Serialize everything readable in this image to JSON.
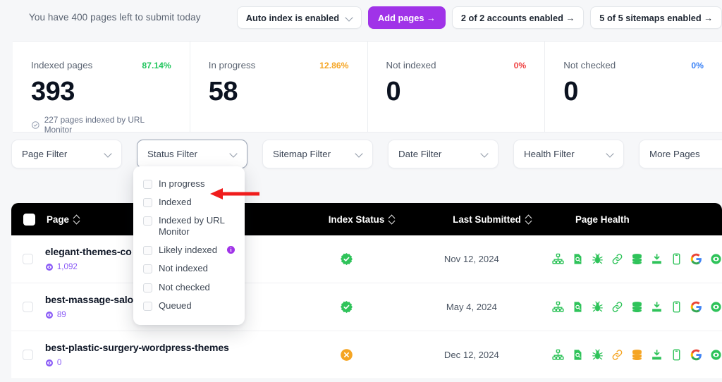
{
  "topbar": {
    "quota_text": "You have 400 pages left to submit today",
    "auto_index_label": "Auto index is enabled",
    "add_pages_label": "Add pages →",
    "accounts_label": "2 of 2 accounts enabled →",
    "sitemaps_label": "5 of 5 sitemaps enabled →"
  },
  "stats": [
    {
      "label": "Indexed pages",
      "percent": "87.14%",
      "percent_color": "#22c55e",
      "value": "393",
      "sub": "227 pages indexed by URL Monitor"
    },
    {
      "label": "In progress",
      "percent": "12.86%",
      "percent_color": "#f5a524",
      "value": "58",
      "sub": ""
    },
    {
      "label": "Not indexed",
      "percent": "0%",
      "percent_color": "#ef4444",
      "value": "0",
      "sub": ""
    },
    {
      "label": "Not checked",
      "percent": "0%",
      "percent_color": "#3b82f6",
      "value": "0",
      "sub": ""
    }
  ],
  "filters": [
    {
      "label": "Page Filter",
      "active": false
    },
    {
      "label": "Status Filter",
      "active": true
    },
    {
      "label": "Sitemap Filter",
      "active": false
    },
    {
      "label": "Date Filter",
      "active": false
    },
    {
      "label": "Health Filter",
      "active": false
    },
    {
      "label": "More Pages",
      "active": false
    }
  ],
  "status_dropdown": {
    "open": true,
    "options": [
      {
        "label": "In progress",
        "checked": false,
        "info": false
      },
      {
        "label": "Indexed",
        "checked": false,
        "info": false
      },
      {
        "label": "Indexed by URL Monitor",
        "checked": false,
        "info": false
      },
      {
        "label": "Likely indexed",
        "checked": false,
        "info": true
      },
      {
        "label": "Not indexed",
        "checked": false,
        "info": false
      },
      {
        "label": "Not checked",
        "checked": false,
        "info": false
      },
      {
        "label": "Queued",
        "checked": false,
        "info": false
      }
    ]
  },
  "annotation": {
    "arrow_color": "#f01c1c",
    "direction": "left"
  },
  "table": {
    "columns": {
      "page": "Page",
      "index_status": "Index Status",
      "last_submitted": "Last Submitted",
      "page_health": "Page Health"
    },
    "rows": [
      {
        "name": "elegant-themes-co",
        "views": "1,092",
        "status": "indexed",
        "last_submitted": "Nov 12, 2024",
        "health": [
          "sitemap-icon",
          "doc-search-icon",
          "bug-icon",
          "link-icon",
          "database-icon",
          "crawl-icon",
          "mobile-icon",
          "google-icon",
          "eye-icon"
        ],
        "health_colors": [
          "#2fc35a",
          "#2fc35a",
          "#2fc35a",
          "#2fc35a",
          "#2fc35a",
          "#2fc35a",
          "#2fc35a",
          "google",
          "#2fc35a"
        ]
      },
      {
        "name": "best-massage-salo",
        "views": "89",
        "status": "indexed",
        "last_submitted": "May 4, 2024",
        "health": [
          "sitemap-icon",
          "doc-search-icon",
          "bug-icon",
          "link-icon",
          "database-icon",
          "crawl-icon",
          "mobile-icon",
          "google-icon",
          "eye-icon"
        ],
        "health_colors": [
          "#2fc35a",
          "#2fc35a",
          "#2fc35a",
          "#2fc35a",
          "#2fc35a",
          "#2fc35a",
          "#2fc35a",
          "google",
          "#2fc35a"
        ]
      },
      {
        "name": "best-plastic-surgery-wordpress-themes",
        "views": "0",
        "status": "not-indexed",
        "last_submitted": "Dec 12, 2024",
        "health": [
          "sitemap-icon",
          "doc-search-icon",
          "bug-icon",
          "link-icon",
          "database-icon",
          "crawl-icon",
          "mobile-icon",
          "google-icon",
          "eye-icon"
        ],
        "health_colors": [
          "#2fc35a",
          "#2fc35a",
          "#2fc35a",
          "#f5a524",
          "#f5a524",
          "#2fc35a",
          "#2fc35a",
          "google",
          "#2fc35a"
        ]
      }
    ]
  },
  "colors": {
    "accent": "#a033e8",
    "success": "#2fc35a",
    "warning": "#f5a524",
    "danger": "#ef4444",
    "header_bg": "#000000"
  }
}
